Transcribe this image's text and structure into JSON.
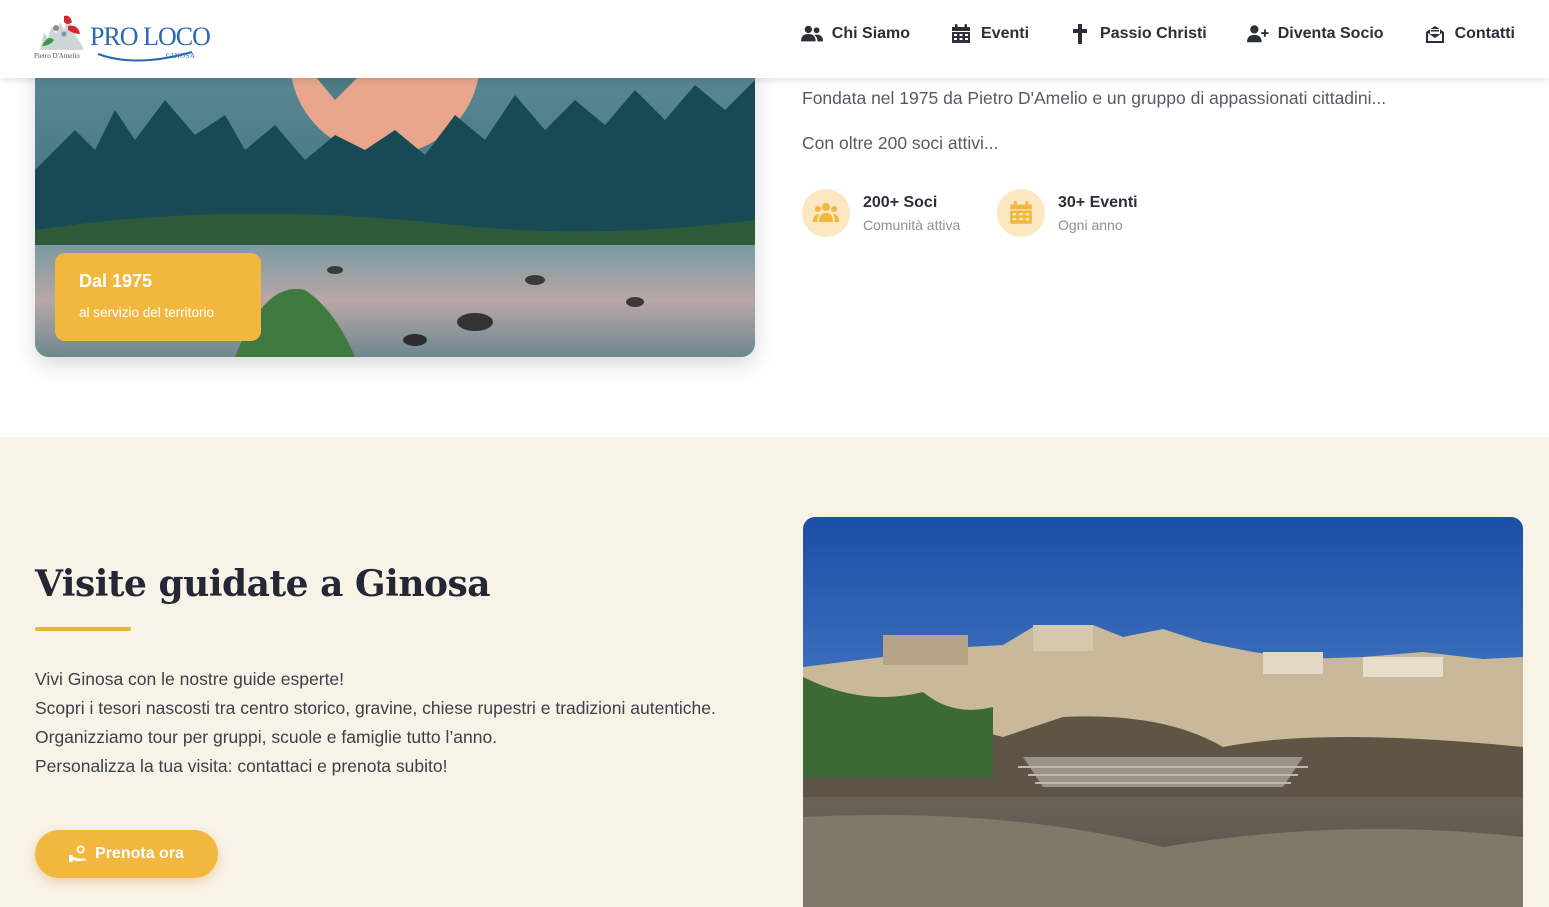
{
  "header": {
    "logo": {
      "brand": "PRO LOCO",
      "town": "GINOSA",
      "subtitle": "Pietro D'Amelio"
    },
    "nav": [
      {
        "label": "Chi Siamo",
        "icon": "users-icon"
      },
      {
        "label": "Eventi",
        "icon": "calendar-icon"
      },
      {
        "label": "Passio Christi",
        "icon": "cross-icon"
      },
      {
        "label": "Diventa Socio",
        "icon": "user-plus-icon"
      },
      {
        "label": "Contatti",
        "icon": "envelope-open-icon"
      }
    ]
  },
  "about": {
    "image": "landscape-river-photo",
    "badge": {
      "title": "Dal 1975",
      "subtitle": "al servizio del territorio"
    },
    "paragraphs": [
      "Fondata nel 1975 da Pietro D'Amelio e un gruppo di appassionati cittadini...",
      "Con oltre 200 soci attivi..."
    ],
    "stats": [
      {
        "title": "200+ Soci",
        "subtitle": "Comunità attiva",
        "icon": "users-icon"
      },
      {
        "title": "30+ Eventi",
        "subtitle": "Ogni anno",
        "icon": "calendar-icon"
      }
    ]
  },
  "tours": {
    "title": "Visite guidate a Ginosa",
    "lines": [
      "Vivi Ginosa con le nostre guide esperte!",
      "Scopri i tesori nascosti tra centro storico, gravine, chiese rupestri e tradizioni autentiche.",
      "Organizziamo tour per gruppi, scuole e famiglie tutto l’anno.",
      "Personalizza la tua visita: contattaci e prenota subito!"
    ],
    "button": "Prenota ora",
    "image": "ginosa-old-town-photo"
  },
  "colors": {
    "accent": "#f2b73f",
    "text": "#2b2f3a",
    "section_bg": "#f9f2e7",
    "brand_blue": "#2a68b0"
  }
}
